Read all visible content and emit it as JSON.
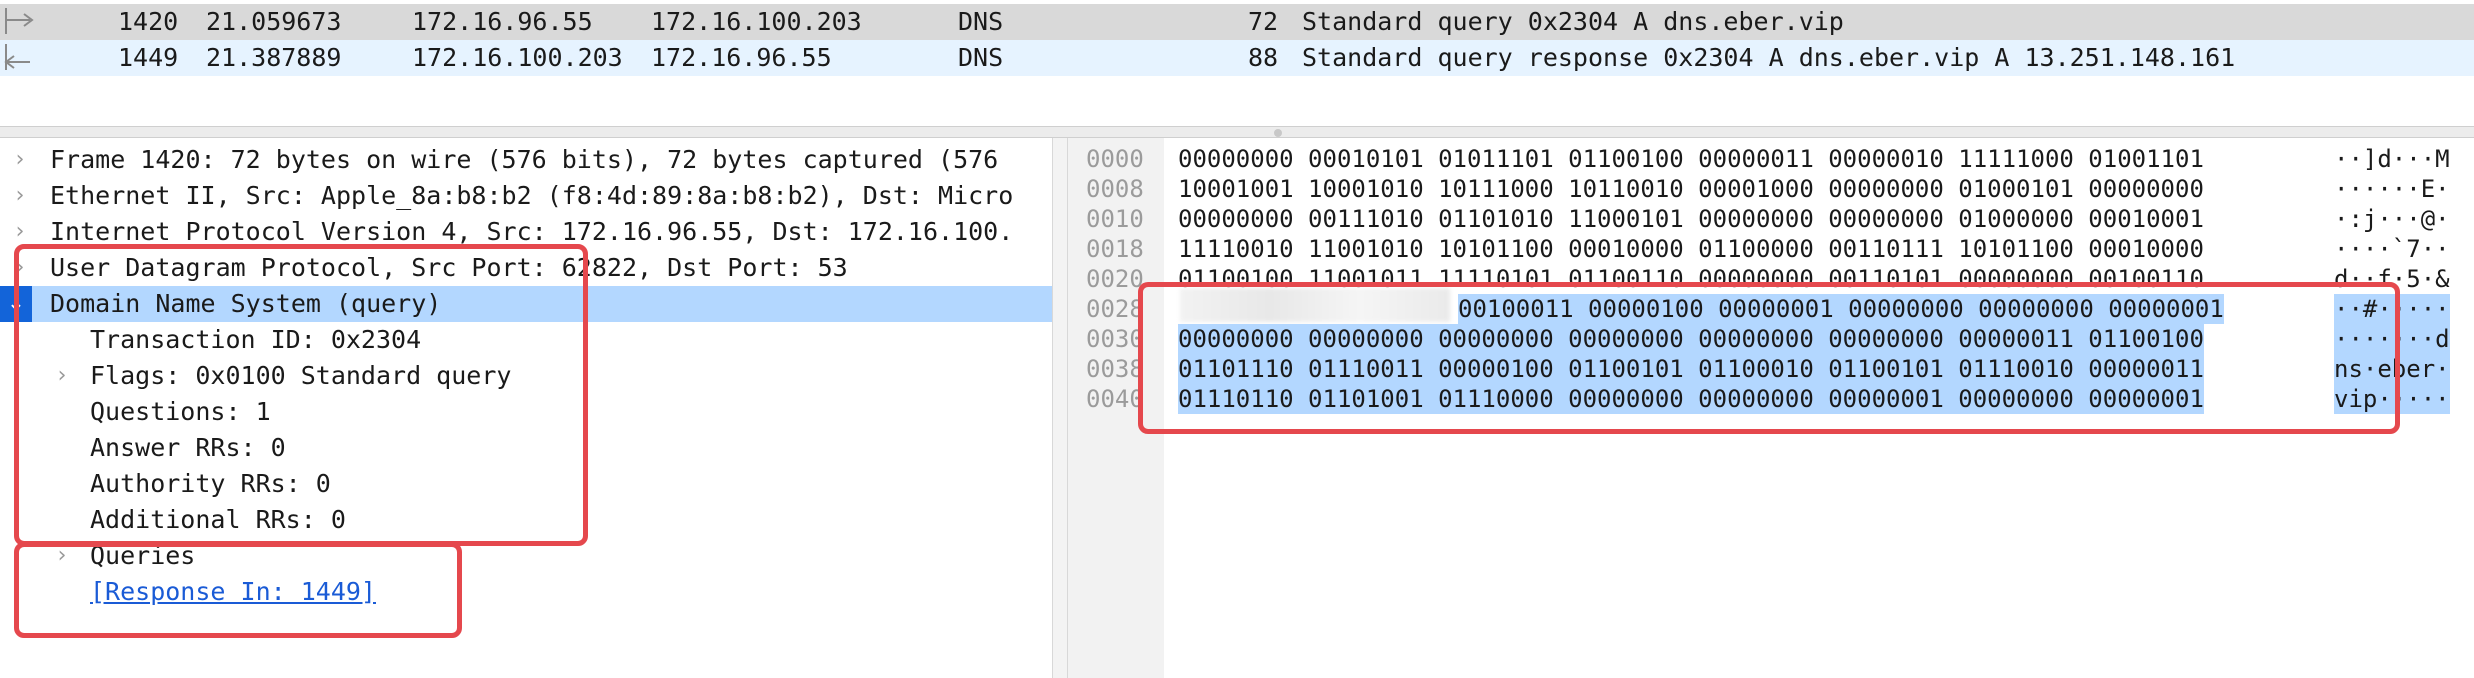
{
  "packet_list": {
    "rows": [
      {
        "no": "1420",
        "time": "21.059673",
        "source": "172.16.96.55",
        "destination": "172.16.100.203",
        "protocol": "DNS",
        "length": "72",
        "info": "Standard query 0x2304 A dns.eber.vip"
      },
      {
        "no": "1449",
        "time": "21.387889",
        "source": "172.16.100.203",
        "destination": "172.16.96.55",
        "protocol": "DNS",
        "length": "88",
        "info": "Standard query response 0x2304 A dns.eber.vip A 13.251.148.161"
      }
    ]
  },
  "details": {
    "frame": "Frame 1420: 72 bytes on wire (576 bits), 72 bytes captured (576",
    "ethernet": "Ethernet II, Src: Apple_8a:b8:b2 (f8:4d:89:8a:b8:b2), Dst: Micro",
    "ip": "Internet Protocol Version 4, Src: 172.16.96.55, Dst: 172.16.100.",
    "udp": "User Datagram Protocol, Src Port: 62822, Dst Port: 53",
    "dns": "Domain Name System (query)",
    "transaction_id": "Transaction ID: 0x2304",
    "flags": "Flags: 0x0100 Standard query",
    "questions": "Questions: 1",
    "answer_rrs": "Answer RRs: 0",
    "authority_rrs": "Authority RRs: 0",
    "additional_rrs": "Additional RRs: 0",
    "queries": "Queries",
    "response_in": "[Response In: 1449]"
  },
  "bytes": {
    "rows": [
      {
        "offset": "0000",
        "bits": "00000000 00010101 01011101 01100100 00000011 00000010 11111000 01001101",
        "ascii": "··]d···M"
      },
      {
        "offset": "0008",
        "bits": "10001001 10001010 10111000 10110010 00001000 00000000 01000101 00000000",
        "ascii": "······E·"
      },
      {
        "offset": "0010",
        "bits": "00000000 00111010 01101010 11000101 00000000 00000000 01000000 00010001",
        "ascii": "·:j···@·"
      },
      {
        "offset": "0018",
        "bits": "11110010 11001010 10101100 00010000 01100000 00110111 10101100 00010000",
        "ascii": "····`7··"
      },
      {
        "offset": "0020",
        "bits": "01100100 11001011 11110101 01100110 00000000 00110101 00000000 00100110",
        "ascii": "d··f·5·&"
      },
      {
        "offset": "0028",
        "bits_plain": "",
        "bits": "00100011 00000100 00000001 00000000 00000000 00000001",
        "ascii": "··#·····"
      },
      {
        "offset": "0030",
        "bits": "00000000 00000000 00000000 00000000 00000000 00000000 00000011 01100100",
        "ascii": "·······d"
      },
      {
        "offset": "0038",
        "bits": "01101110 01110011 00000100 01100101 01100010 01100101 01110010 00000011",
        "ascii": "ns·eber·"
      },
      {
        "offset": "0040",
        "bits": "01110110 01101001 01110000 00000000 00000000 00000001 00000000 00000001",
        "ascii": "vip·····"
      }
    ]
  },
  "colors": {
    "annotation": "#e5484d",
    "selection": "#b3d7ff",
    "selected_row": "#d9d9d9",
    "related_row": "#e6f3ff",
    "link": "#1a5bd6"
  }
}
